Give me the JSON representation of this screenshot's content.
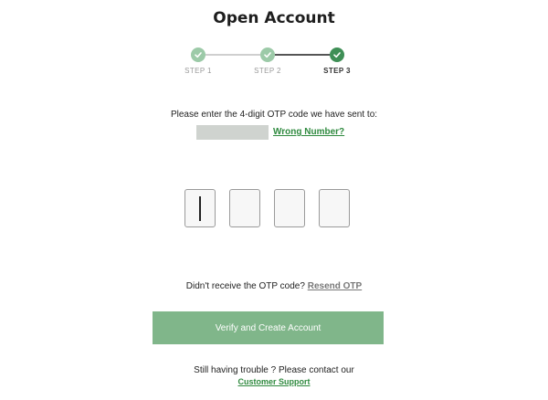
{
  "header": {
    "title": "Open Account"
  },
  "stepper": {
    "steps": [
      {
        "label": "STEP 1",
        "state": "done"
      },
      {
        "label": "STEP 2",
        "state": "done"
      },
      {
        "label": "STEP 3",
        "state": "current"
      }
    ],
    "done_color": "#9ccaa8",
    "current_color": "#3f8f56"
  },
  "otp": {
    "instruction": "Please enter the 4-digit OTP code we have sent to:",
    "wrong_number_label": "Wrong Number?",
    "digits": [
      "",
      "",
      "",
      ""
    ]
  },
  "resend": {
    "prompt": "Didn't receive the OTP code?",
    "link_label": "Resend OTP"
  },
  "actions": {
    "verify_label": "Verify and Create Account",
    "verify_color": "#80b68a"
  },
  "footer": {
    "trouble_text": "Still having trouble ? Please contact our",
    "support_label": "Customer Support"
  }
}
